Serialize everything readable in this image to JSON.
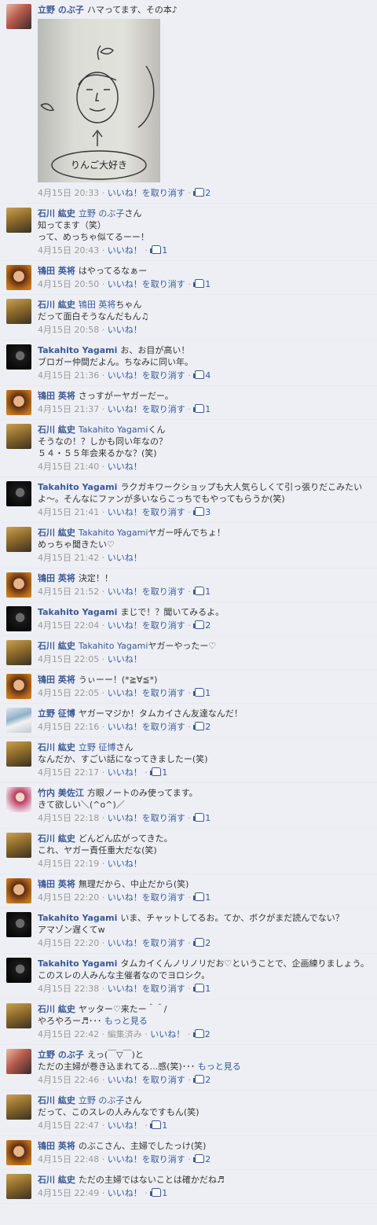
{
  "like_label": "いいね！",
  "unlike_label": "いいね！を取り消す",
  "edited_label": "編集済み",
  "see_more_label": "もっと見る",
  "photo_text": "りんご大好き",
  "comments": [
    {
      "author": "立野 のぶ子",
      "avatar": "nobuko",
      "mention": "",
      "text": "ハマってます、その本♪",
      "text2": "",
      "time": "4月15日 20:33",
      "liked": true,
      "likes": "2",
      "photo": true,
      "edited": false,
      "more": false
    },
    {
      "author": "石川 紘史",
      "avatar": "koushi",
      "mention": "立野 のぶ子",
      "text": "さん",
      "text2": "知ってます（笑）\nって、めっちゃ似てるーー！",
      "time": "4月15日 20:43",
      "liked": false,
      "likes": "1",
      "photo": false,
      "edited": false,
      "more": false
    },
    {
      "author": "鴇田 英将",
      "avatar": "eisho",
      "mention": "",
      "text": "はやってるなぁー",
      "text2": "",
      "time": "4月15日 20:50",
      "liked": true,
      "likes": "1",
      "photo": false,
      "edited": false,
      "more": false
    },
    {
      "author": "石川 紘史",
      "avatar": "koushi",
      "mention": "鴇田 英将",
      "text": "ちゃん",
      "text2": "だって面白そうなんだもん♫",
      "time": "4月15日 20:58",
      "liked": false,
      "likes": "",
      "photo": false,
      "edited": false,
      "more": false
    },
    {
      "author": "Takahito Yagami",
      "avatar": "yagami",
      "mention": "",
      "text": "お、お目が高い！",
      "text2": "ブロガー仲間だよん。ちなみに同い年。",
      "time": "4月15日 21:36",
      "liked": true,
      "likes": "4",
      "photo": false,
      "edited": false,
      "more": false
    },
    {
      "author": "鴇田 英将",
      "avatar": "eisho",
      "mention": "",
      "text": "さっすがーヤガーだー。",
      "text2": "",
      "time": "4月15日 21:37",
      "liked": true,
      "likes": "1",
      "photo": false,
      "edited": false,
      "more": false
    },
    {
      "author": "石川 紘史",
      "avatar": "koushi",
      "mention": "Takahito Yagami",
      "text": "くん",
      "text2": "そうなの！？しかも同い年なの？\n５４・５５年会来るかな？(笑)",
      "time": "4月15日 21:40",
      "liked": false,
      "likes": "",
      "photo": false,
      "edited": false,
      "more": false
    },
    {
      "author": "Takahito Yagami",
      "avatar": "yagami",
      "mention": "",
      "text": "ラクガキワークショップも大人気らしくて引っ張りだこみたいよ〜。そんなにファンが多いならこっちでもやってもらうか(笑)",
      "text2": "",
      "time": "4月15日 21:41",
      "liked": true,
      "likes": "3",
      "photo": false,
      "edited": false,
      "more": false
    },
    {
      "author": "石川 紘史",
      "avatar": "koushi",
      "mention": "Takahito Yagami",
      "text": "ヤガー呼んでちょ！",
      "text2": "めっちゃ聞きたい♡",
      "time": "4月15日 21:42",
      "liked": false,
      "likes": "",
      "photo": false,
      "edited": false,
      "more": false
    },
    {
      "author": "鴇田 英将",
      "avatar": "eisho",
      "mention": "",
      "text": "決定！！",
      "text2": "",
      "time": "4月15日 21:52",
      "liked": true,
      "likes": "1",
      "photo": false,
      "edited": false,
      "more": false
    },
    {
      "author": "Takahito Yagami",
      "avatar": "yagami",
      "mention": "",
      "text": "まじで！？聞いてみるよ。",
      "text2": "",
      "time": "4月15日 22:04",
      "liked": true,
      "likes": "2",
      "photo": false,
      "edited": false,
      "more": false
    },
    {
      "author": "石川 紘史",
      "avatar": "koushi",
      "mention": "Takahito Yagami",
      "text": "ヤガーやったー♡",
      "text2": "",
      "time": "4月15日 22:05",
      "liked": false,
      "likes": "",
      "photo": false,
      "edited": false,
      "more": false
    },
    {
      "author": "鴇田 英将",
      "avatar": "eisho",
      "mention": "",
      "text": "うぃーー！(*≧∀≦*)",
      "text2": "",
      "time": "4月15日 22:05",
      "liked": true,
      "likes": "1",
      "photo": false,
      "edited": false,
      "more": false
    },
    {
      "author": "立野 征博",
      "avatar": "yukihiro",
      "mention": "",
      "text": "ヤガーマジか！タムカイさん友達なんだ！",
      "text2": "",
      "time": "4月15日 22:16",
      "liked": true,
      "likes": "2",
      "photo": false,
      "edited": false,
      "more": false
    },
    {
      "author": "石川 紘史",
      "avatar": "koushi",
      "mention": "立野 征博",
      "text": "さん",
      "text2": "なんだか、すごい話になってきましたー(笑)",
      "time": "4月15日 22:17",
      "liked": false,
      "likes": "1",
      "photo": false,
      "edited": false,
      "more": false
    },
    {
      "author": "竹内 美佐江",
      "avatar": "misae",
      "mention": "",
      "text": "方眼ノートのみ使ってます。",
      "text2": "きて欲しい＼(^o^)／",
      "time": "4月15日 22:18",
      "liked": true,
      "likes": "1",
      "photo": false,
      "edited": false,
      "more": false
    },
    {
      "author": "石川 紘史",
      "avatar": "koushi",
      "mention": "",
      "text": "どんどん広がってきた。",
      "text2": "これ、ヤガー責任重大だな(笑)",
      "time": "4月15日 22:19",
      "liked": false,
      "likes": "",
      "photo": false,
      "edited": false,
      "more": false
    },
    {
      "author": "鴇田 英将",
      "avatar": "eisho",
      "mention": "",
      "text": "無理だから、中止だから(笑)",
      "text2": "",
      "time": "4月15日 22:20",
      "liked": true,
      "likes": "1",
      "photo": false,
      "edited": false,
      "more": false
    },
    {
      "author": "Takahito Yagami",
      "avatar": "yagami",
      "mention": "",
      "text": "いま、チャットしてるお。てか、ボクがまだ読んでない？",
      "text2": "アマゾン遅くてw",
      "time": "4月15日 22:20",
      "liked": true,
      "likes": "2",
      "photo": false,
      "edited": false,
      "more": false
    },
    {
      "author": "Takahito Yagami",
      "avatar": "yagami",
      "mention": "",
      "text": "タムカイくんノリノリだお♡ということで、企画練りましょう。このスレの人みんな主催者なのでヨロシク。",
      "text2": "",
      "time": "4月15日 22:38",
      "liked": true,
      "likes": "1",
      "photo": false,
      "edited": false,
      "more": false
    },
    {
      "author": "石川 紘史",
      "avatar": "koushi",
      "mention": "",
      "text": "ヤッター♡来たー＾＾/",
      "text2": "やろやろー♬･･･",
      "time": "4月15日 22:42",
      "liked": false,
      "likes": "2",
      "photo": false,
      "edited": true,
      "more": true
    },
    {
      "author": "立野 のぶ子",
      "avatar": "nobuko",
      "mention": "",
      "text": "えっ(￣▽￣)と",
      "text2": "ただの主婦が巻き込まれてる...感(笑)･･･",
      "time": "4月15日 22:46",
      "liked": true,
      "likes": "2",
      "photo": false,
      "edited": false,
      "more": true
    },
    {
      "author": "石川 紘史",
      "avatar": "koushi",
      "mention": "立野 のぶ子",
      "text": "さん",
      "text2": "だって、このスレの人みんなですもん(笑)",
      "time": "4月15日 22:47",
      "liked": false,
      "likes": "1",
      "photo": false,
      "edited": false,
      "more": false
    },
    {
      "author": "鴇田 英将",
      "avatar": "eisho",
      "mention": "",
      "text": "のぶこさん、主婦でしたっけ(笑)",
      "text2": "",
      "time": "4月15日 22:48",
      "liked": true,
      "likes": "2",
      "photo": false,
      "edited": false,
      "more": false
    },
    {
      "author": "石川 紘史",
      "avatar": "koushi",
      "mention": "",
      "text": "ただの主婦ではないことは確かだね♬",
      "text2": "",
      "time": "4月15日 22:49",
      "liked": false,
      "likes": "1",
      "photo": false,
      "edited": false,
      "more": false
    }
  ]
}
